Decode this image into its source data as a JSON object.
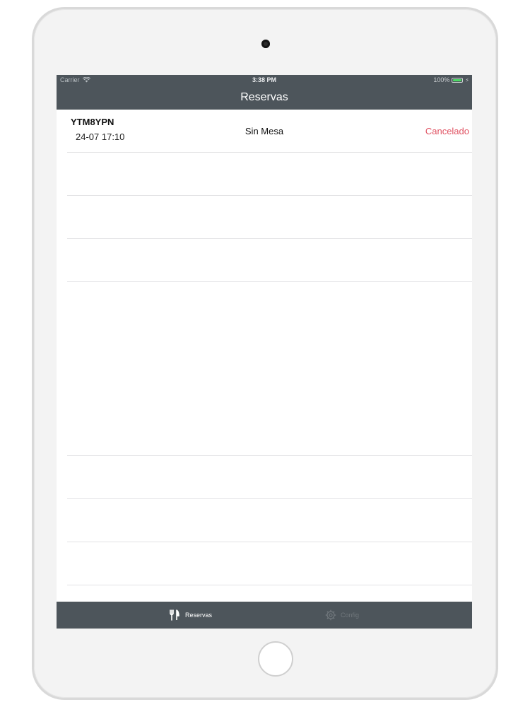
{
  "status_bar": {
    "carrier": "Carrier",
    "time": "3:38 PM",
    "battery": "100%"
  },
  "nav": {
    "title": "Reservas"
  },
  "reservations": [
    {
      "code": "YTM8YPN",
      "datetime": "24-07 17:10",
      "table": "Sin Mesa",
      "status": "Cancelado"
    }
  ],
  "tabs": [
    {
      "label": "Reservas",
      "icon": "fork-knife-icon",
      "active": true
    },
    {
      "label": "Config",
      "icon": "gear-icon",
      "active": false
    }
  ],
  "colors": {
    "bar_background": "#4d555b",
    "status_cancelled": "#e05363",
    "battery_green": "#4cd964"
  }
}
